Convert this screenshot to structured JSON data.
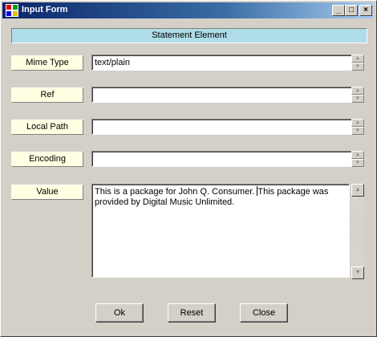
{
  "window": {
    "title": "Input Form",
    "controls": {
      "minimize": "_",
      "maximize": "□",
      "close": "×"
    }
  },
  "section": {
    "title": "Statement Element"
  },
  "fields": [
    {
      "label": "Mime Type",
      "value": "text/plain"
    },
    {
      "label": "Ref",
      "value": ""
    },
    {
      "label": "Local Path",
      "value": ""
    },
    {
      "label": "Encoding",
      "value": ""
    }
  ],
  "value_field": {
    "label": "Value",
    "text_before_caret": "This is a package for John Q. Consumer. ",
    "text_after_caret": "This package was provided by Digital Music Unlimited."
  },
  "buttons": {
    "ok": "Ok",
    "reset": "Reset",
    "close": "Close"
  },
  "icons": {
    "app": "form-window-icon",
    "spin_up": "spin-up-arrow-icon",
    "spin_down": "spin-down-arrow-icon"
  },
  "colors": {
    "title_gradient_start": "#0a246a",
    "title_gradient_end": "#a6caf0",
    "section_header_bg": "#aedce8",
    "label_bg": "#ffffe1",
    "window_bg": "#d4d0c8"
  }
}
